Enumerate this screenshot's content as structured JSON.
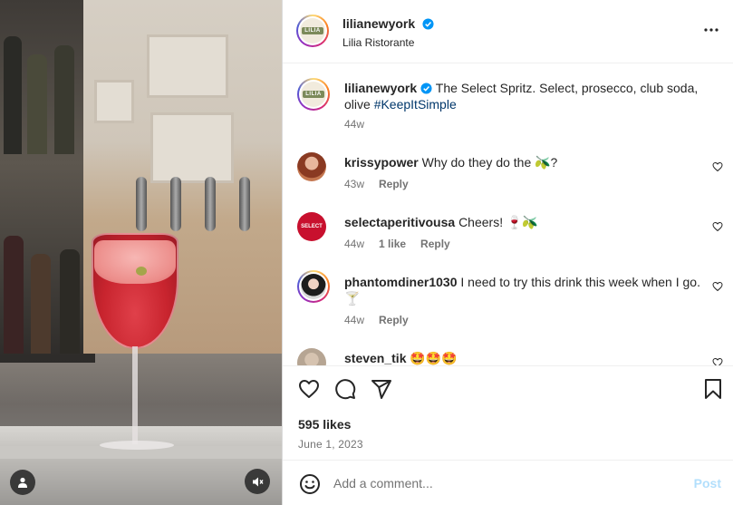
{
  "header": {
    "username": "lilianewyork",
    "location": "Lilia Ristorante",
    "logo_text": "LILIA"
  },
  "caption": {
    "username": "lilianewyork",
    "text": "The Select Spritz. Select, prosecco, club soda, olive",
    "hashtag": "#KeepItSimple",
    "time": "44w"
  },
  "comments": [
    {
      "username": "krissypower",
      "text": "Why do they do the 🫒?",
      "time": "43w",
      "likes": "",
      "reply": "Reply"
    },
    {
      "username": "selectaperitivousa",
      "text": "Cheers! 🍷🫒",
      "time": "44w",
      "likes": "1 like",
      "reply": "Reply",
      "avatar_text": "SELECT"
    },
    {
      "username": "phantomdiner1030",
      "text": "I need to try this drink this week when I go. 🍸",
      "time": "44w",
      "likes": "",
      "reply": "Reply"
    },
    {
      "username": "steven_tik",
      "text": "🤩🤩🤩",
      "time": "",
      "likes": "",
      "reply": ""
    }
  ],
  "post": {
    "likes": "595 likes",
    "date": "June 1, 2023"
  },
  "composer": {
    "placeholder": "Add a comment...",
    "post_label": "Post"
  },
  "colors": {
    "verified": "#0095f6",
    "link": "#00376b",
    "post_disabled": "#b2dffc",
    "select_red": "#c8102e"
  },
  "icons": [
    "more-icon",
    "verified-icon",
    "heart-icon",
    "comment-icon",
    "share-icon",
    "bookmark-icon",
    "emoji-icon",
    "user-tag-icon",
    "mute-icon"
  ]
}
